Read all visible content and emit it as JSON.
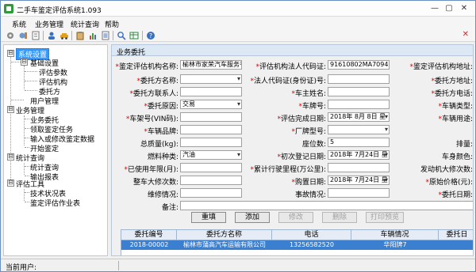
{
  "window": {
    "title": "二手车鉴定评估系统1.093",
    "minimize": "—",
    "restore": "▢",
    "close": "✕"
  },
  "menubar": [
    "系统",
    "业务管理",
    "统计查询",
    "帮助"
  ],
  "toolbar": {
    "icons": [
      "gear-icon",
      "settings-icon",
      "document-icon",
      "user-icon",
      "car-icon",
      "clipboard-icon",
      "chart-icon",
      "list-icon",
      "search-icon",
      "table-icon",
      "help-icon"
    ],
    "close": "✕"
  },
  "tree": {
    "nodes": [
      {
        "label": "系统设置",
        "toggle": "⊟",
        "selected": true
      },
      {
        "label": "基础设置",
        "toggle": "⊟"
      },
      {
        "label": "评估参数"
      },
      {
        "label": "评估机构"
      },
      {
        "label": "委托方"
      },
      {
        "label": "用户管理"
      },
      {
        "label": "业务管理",
        "toggle": "⊟"
      },
      {
        "label": "业务委托"
      },
      {
        "label": "领取鉴定任务"
      },
      {
        "label": "输入或修改鉴定数据"
      },
      {
        "label": "开始鉴定"
      },
      {
        "label": "统计查询",
        "toggle": "⊟"
      },
      {
        "label": "统计查询"
      },
      {
        "label": "输出报表"
      },
      {
        "label": "评估工具",
        "toggle": "⊟"
      },
      {
        "label": "技术状况表"
      },
      {
        "label": "鉴定评估作业表"
      }
    ]
  },
  "panel": {
    "title": "业务委托",
    "fields": {
      "org_name": {
        "label": "鉴定评估机构名称:",
        "value": "榆林市家荣汽车服务有"
      },
      "legal_cert": {
        "label": "评估机构法人代码证:",
        "value": "91610802MA7094H494"
      },
      "org_addr": {
        "label": "鉴定评估机构地址:",
        "value": ""
      },
      "client_name": {
        "label": "委托方名称:",
        "value": ""
      },
      "legal_id": {
        "label": "法人代码证(身份证)号:",
        "value": ""
      },
      "client_addr": {
        "label": "委托方地址:",
        "value": ""
      },
      "client_contact": {
        "label": "委托方联系人:",
        "value": ""
      },
      "owner_name": {
        "label": "车主姓名:",
        "value": ""
      },
      "client_phone": {
        "label": "委托方电话:",
        "value": ""
      },
      "reason": {
        "label": "委托原因:",
        "value": "交易"
      },
      "plate": {
        "label": "车牌号:",
        "value": ""
      },
      "vehicle_type": {
        "label": "车辆类型:",
        "value": ""
      },
      "vin": {
        "label": "车架号(VIN码):",
        "value": ""
      },
      "eval_date": {
        "label": "评估完成日期:",
        "value": "2018年 8月 8日 星"
      },
      "usage": {
        "label": "车辆用途:",
        "value": ""
      },
      "brand": {
        "label": "车辆品牌:",
        "value": ""
      },
      "model": {
        "label": "厂牌型号:",
        "value": ""
      },
      "curb_weight": {
        "label": "总质量(kg):",
        "value": ""
      },
      "seats": {
        "label": "座位数:",
        "value": "5"
      },
      "displacement": {
        "label": "排量:",
        "value": ""
      },
      "fuel": {
        "label": "燃料种类:",
        "value": "汽油"
      },
      "reg_date": {
        "label": "初次登记日期:",
        "value": "2018年 7月24日 星"
      },
      "color": {
        "label": "车身颜色:",
        "value": ""
      },
      "used_months": {
        "label": "已使用年限(月):",
        "value": ""
      },
      "mileage": {
        "label": "累计行驶里程(万公里):",
        "value": ""
      },
      "engine_repairs": {
        "label": "发动机大修次数:",
        "value": ""
      },
      "body_repairs": {
        "label": "整车大修次数:",
        "value": ""
      },
      "purchase_date": {
        "label": "购置日期:",
        "value": "2018年 7月24日 星"
      },
      "orig_price": {
        "label": "原始价格(元):",
        "value": ""
      },
      "maintenance": {
        "label": "维修情况:",
        "value": ""
      },
      "accidents": {
        "label": "事故情况:",
        "value": ""
      },
      "entrust_date": {
        "label": "委托日期:",
        "value": ""
      },
      "remarks": {
        "label": "备注:",
        "value": ""
      }
    },
    "buttons": [
      {
        "label": "重填",
        "enabled": true
      },
      {
        "label": "添加",
        "enabled": true
      },
      {
        "label": "修改",
        "enabled": false
      },
      {
        "label": "删除",
        "enabled": false
      },
      {
        "label": "打印预览",
        "enabled": false
      }
    ],
    "grid": {
      "columns": [
        "委托编号",
        "委托方名称",
        "电话",
        "车辆情况",
        "委托日"
      ],
      "rows": [
        [
          "2018-00002",
          "榆林市蒲高汽车运输有限公司",
          "13256582520",
          "华阳牌7",
          ""
        ]
      ]
    }
  },
  "status": {
    "label": "当前用户:"
  },
  "colors": {
    "selection": "#3399ff",
    "required": "#e00000",
    "grid_row": "#3a7fd0"
  }
}
